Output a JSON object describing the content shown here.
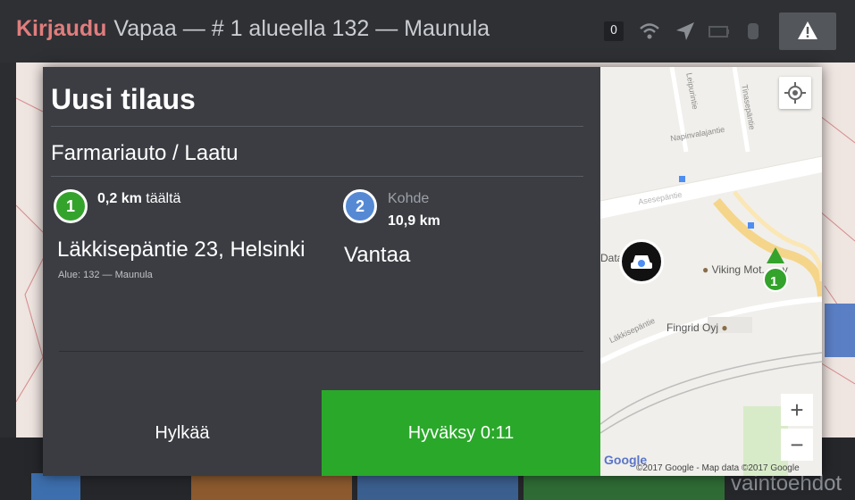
{
  "topbar": {
    "login_label": "Kirjaudu",
    "status_text": "Vapaa — # 1 alueella 132 — Maunula",
    "counter": "0",
    "icons": [
      "wifi-icon",
      "navigation-arrow-icon",
      "battery-icon",
      "gps-icon"
    ],
    "warning_icon": "warning-icon"
  },
  "modal": {
    "title": "Uusi tilaus",
    "vehicle_type": "Farmariauto / Laatu",
    "pickup": {
      "badge": "1",
      "distance_value": "0,2 km",
      "distance_suffix": "täältä",
      "address": "Läkkisepäntie 23, Helsinki",
      "area": "Alue: 132 — Maunula"
    },
    "destination": {
      "badge": "2",
      "label": "Kohde",
      "distance": "10,9 km",
      "address": "Vantaa"
    },
    "reject_label": "Hylkää",
    "accept_label": "Hyväksy  0:11"
  },
  "map": {
    "streets": [
      "Leipurintie",
      "Tinasepäntie",
      "Napinvalajantie",
      "Asesepäntie",
      "Läkkisepäntie"
    ],
    "pois": [
      "Viking Mot... ...y",
      "Fingrid Oyj",
      "Data..."
    ],
    "marker_label": "1",
    "zoom_in": "+",
    "zoom_out": "−",
    "google_logo": "Google",
    "copyright": "©2017 Google - Map data ©2017 Google"
  },
  "bottombar": {
    "right_label": "vaintoehdot"
  },
  "colors": {
    "accept_green": "#2aa82a",
    "pickup_badge": "#34a32c",
    "destination_badge": "#5689d4",
    "login_red": "#e07d7d"
  }
}
